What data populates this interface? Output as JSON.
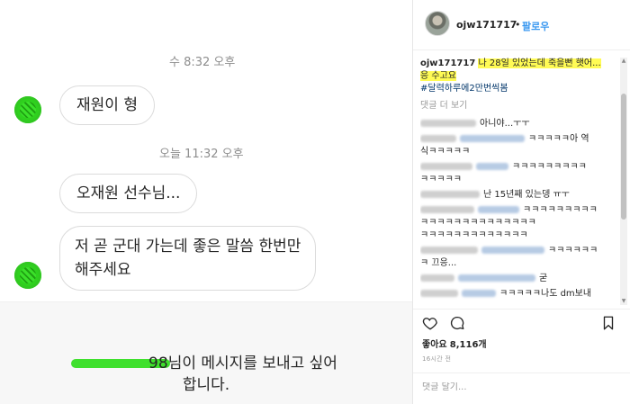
{
  "chat": {
    "timestamp_1": "수 8:32 오후",
    "timestamp_2": "오늘 11:32 오후",
    "messages": [
      "재원이 형",
      "오재원 선수님...",
      "저 곧 군대 가는데 좋은 말씀 한번만",
      "해주세요"
    ],
    "request_name_visible": "98",
    "request_text_line1": "님이 메시지를 보내고 싶어",
    "request_text_line2": "합니다."
  },
  "post": {
    "username": "ojw171717",
    "separator": "•",
    "follow_label": "팔로우",
    "caption_user": "ojw171717",
    "caption_line1": "나 28일 있었는데 죽을뻔 햇어...",
    "caption_line2": "응 수고요",
    "hashtag": "#달력하루에2만번씩봄",
    "more_comments_label": "댓글 더 보기",
    "comments": [
      "아니야...ㅜㅜ",
      "ㅋㅋㅋㅋㅋ아 역",
      "식ㅋㅋㅋㅋㅋ",
      "ㅋㅋㅋㅋㅋㅋㅋㅋㅋ",
      "ㅋㅋㅋㅋㅋ",
      "난 15년째 있는뎅 ㅠㅜ",
      "ㅋㅋㅋㅋㅋㅋㅋㅋㅋ",
      "ㅋㅋㅋㅋㅋㅋㅋㅋㅋㅋㅋㅋㅋㅋ",
      "ㅋㅋㅋㅋㅋㅋㅋㅋㅋㅋㅋㅋㅋ",
      "ㅋㅋㅋㅋㅋㅋ",
      "ㅋ 끄응...",
      "굳",
      "ㅋㅋㅋㅋㅋ나도 dm보내"
    ],
    "likes_label": "좋아요",
    "likes_count": "8,116개",
    "time_ago": "16시간 전",
    "comment_placeholder": "댓글 달기..."
  },
  "colors": {
    "accent_blue": "#3897f0",
    "highlight_yellow": "#fffb55",
    "scribble_green": "#3fe02d"
  }
}
